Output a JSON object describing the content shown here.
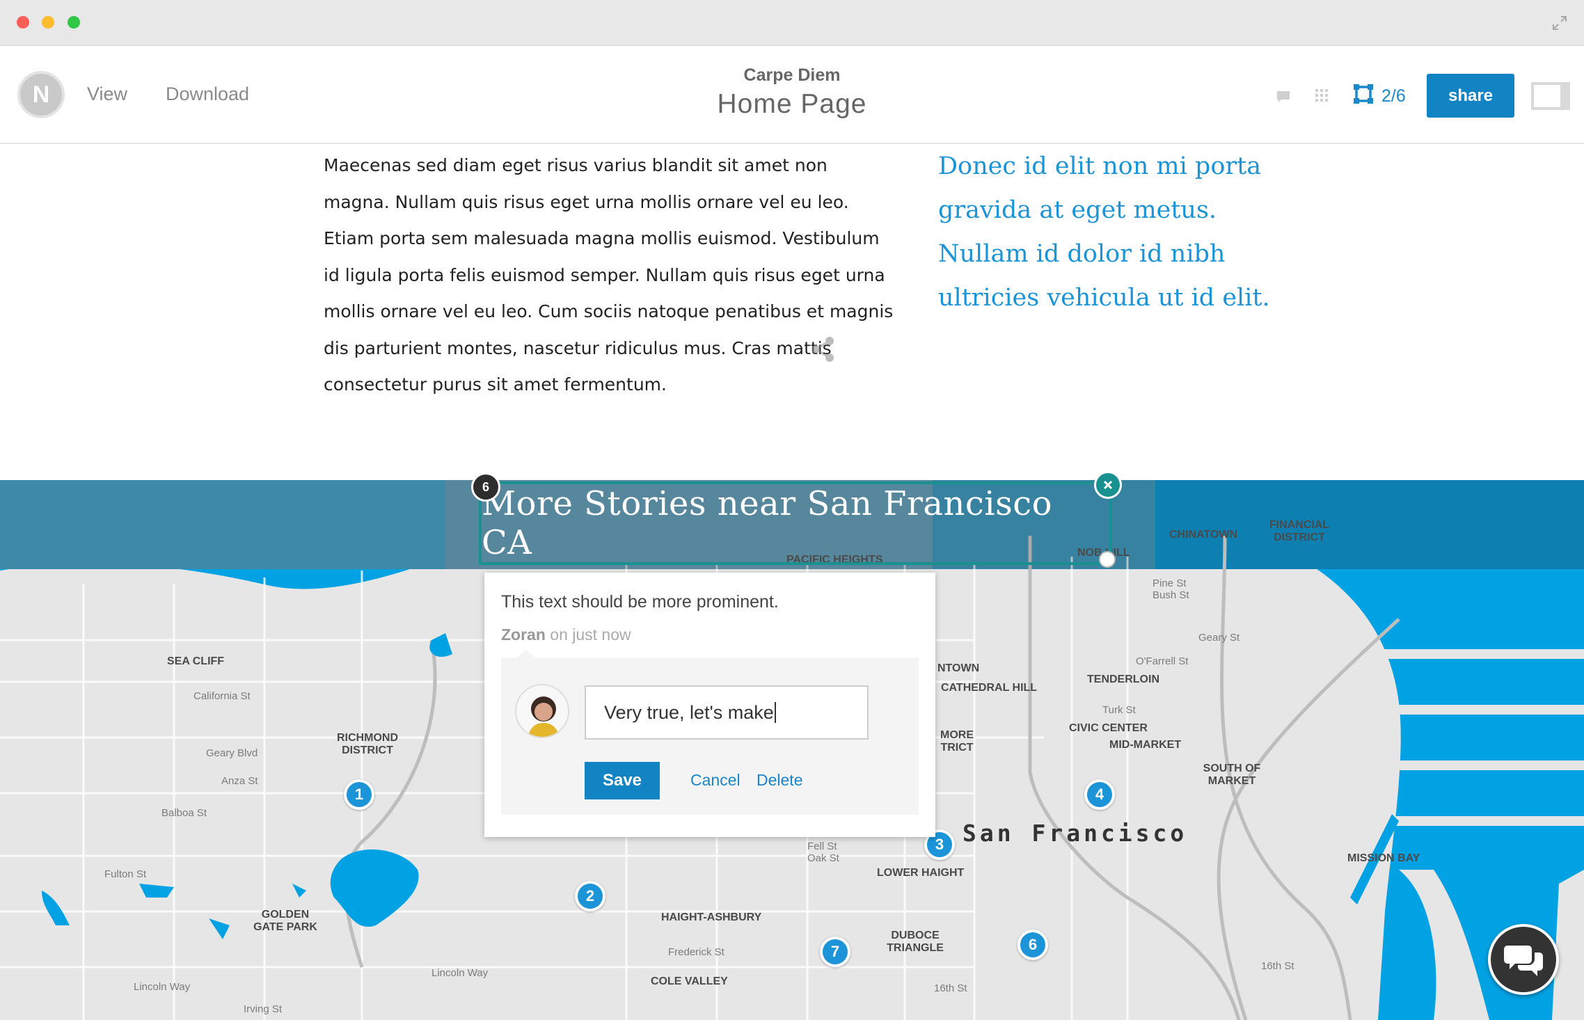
{
  "header": {
    "logo_letter": "N",
    "nav": {
      "view": "View",
      "download": "Download"
    },
    "project_name": "Carpe Diem",
    "page_name": "Home Page",
    "artboard_counter": "2/6",
    "share_label": "share"
  },
  "content": {
    "body_text": "Maecenas sed diam eget risus varius blandit sit amet non magna. Nullam quis risus eget urna mollis ornare vel eu leo. Etiam porta sem malesuada magna mollis euismod. Vestibulum id ligula porta felis euismod semper. Nullam quis risus eget urna mollis ornare vel eu leo. Cum sociis natoque penatibus et magnis dis parturient montes, nascetur ridiculus mus. Cras mattis consectetur purus sit amet fermentum.",
    "pull_quote": "Donec id elit non mi porta gravida at eget metus. Nullam id dolor id nibh ultricies vehicula ut id elit."
  },
  "map": {
    "heading": "More Stories near San Francisco CA",
    "city": "San Francisco",
    "neighborhoods": {
      "sea_cliff": "SEA CLIFF",
      "richmond": "RICHMOND DISTRICT",
      "golden_gate_park": "GOLDEN GATE PARK",
      "haight_ashbury": "HAIGHT-ASHBURY",
      "cole_valley": "COLE VALLEY",
      "duboce_triangle": "DUBOCE TRIANGLE",
      "lower_haight": "LOWER HAIGHT",
      "tenderloin": "TENDERLOIN",
      "civic_center": "CIVIC CENTER",
      "mid_market": "MID-MARKET",
      "cathedral_hill": "CATHEDRAL HILL",
      "south_of_market": "SOUTH OF MARKET",
      "mission_bay": "MISSION BAY",
      "chinatown": "CHINATOWN",
      "financial_district": "FINANCIAL DISTRICT",
      "nob_hill": "NOB HILL",
      "pacific_heights": "PACIFIC HEIGHTS",
      "japantown": "NTOWN",
      "western_addition": "MORE TRICT"
    },
    "streets": {
      "geary": "Geary Blvd",
      "balboa": "Balboa St",
      "fulton": "Fulton St",
      "lincoln_way": "Lincoln Way",
      "irving": "Irving St",
      "fell_oak": "Fell St Oak St",
      "frederick": "Frederick St",
      "sixteenth": "16th St",
      "california": "California St",
      "anza": "Anza St",
      "turk": "Turk St",
      "ofarrell": "O'Farrell St",
      "geary_st": "Geary St",
      "pine_bush": "Pine St Bush St"
    },
    "pins": [
      "1",
      "2",
      "3",
      "4",
      "6",
      "7"
    ]
  },
  "note": {
    "number": "6",
    "comment": "This text should be more prominent.",
    "author": "Zoran",
    "timestamp": "on just now",
    "reply_value": "Very true, let's make",
    "save_label": "Save",
    "cancel_label": "Cancel",
    "delete_label": "Delete"
  },
  "colors": {
    "accent": "#1284c3",
    "note_border": "#1a9191",
    "water": "#00a0e3",
    "link_blue": "#1a94d6"
  },
  "icons": {
    "share": "share-icon",
    "comment_mode": "comment-icon",
    "grid": "grid-icon",
    "artboard": "artboard-icon",
    "chat": "chat-icon",
    "close": "close-icon",
    "fullscreen": "fullscreen-icon"
  }
}
